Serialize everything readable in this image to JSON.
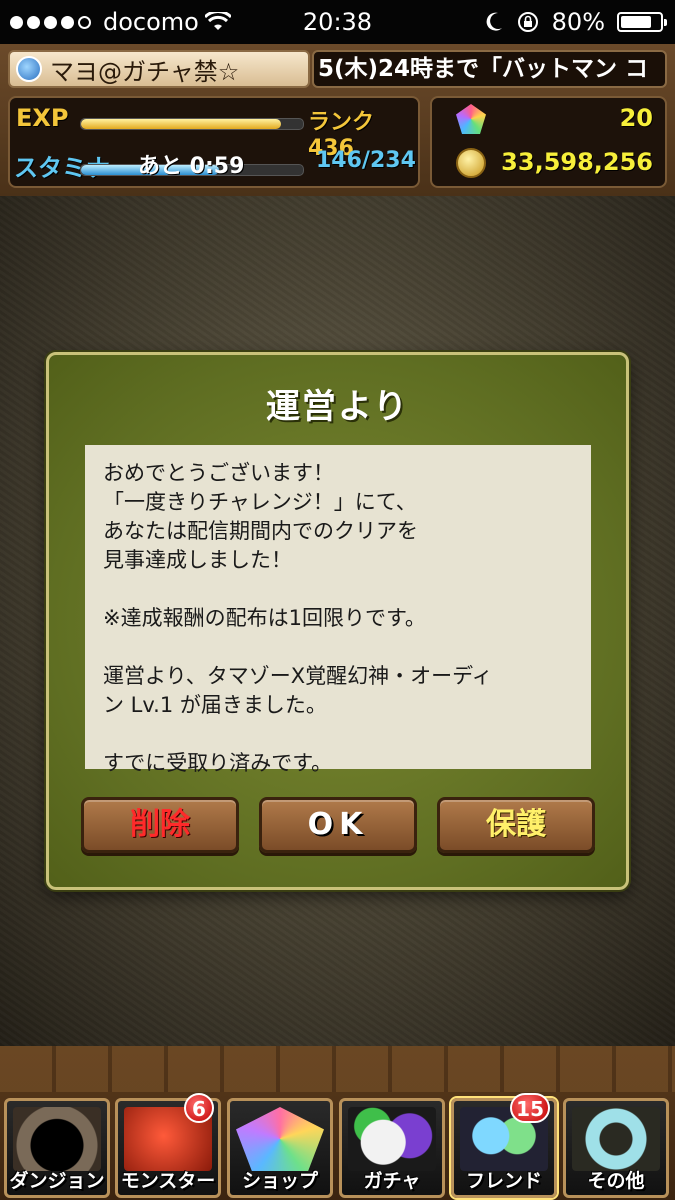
{
  "status_bar": {
    "carrier": "docomo",
    "time": "20:38",
    "battery": "80%",
    "battery_level": 0.8,
    "signal_bars_filled": 4,
    "signal_bars_total": 5
  },
  "header": {
    "player_name": "マヨ@ガチャ禁☆",
    "ticker_text": "5(木)24時まで「バットマン コ",
    "exp_label": "EXP",
    "exp_progress": 0.9,
    "rank": "ランク 436",
    "stamina_label": "スタミナ",
    "stamina_timer": "あと 0:59",
    "stamina_progress": 0.62,
    "stamina_value": "146/234",
    "magic_stones": "20",
    "coins": "33,598,256"
  },
  "dialog": {
    "title": "運営より",
    "message": [
      "おめでとうございます！\n「一度きりチャレンジ！」にて、\nあなたは配信期間内でのクリアを\n見事達成しました！",
      "※達成報酬の配布は1回限りです。",
      "運営より、タマゾーX覚醒幻神・オーディ\nン Lv.1 が届きました。",
      "すでに受取り済みです。"
    ],
    "buttons": {
      "delete": "削除",
      "ok": "OK",
      "protect": "保護"
    }
  },
  "nav": {
    "items": [
      {
        "label": "ダンジョン",
        "icon": "dungeon-gate-icon",
        "badge": ""
      },
      {
        "label": "モンスター",
        "icon": "monster-dragon-icon",
        "badge": "6"
      },
      {
        "label": "ショップ",
        "icon": "magic-stone-icon",
        "badge": ""
      },
      {
        "label": "ガチャ",
        "icon": "egg-icon",
        "badge": ""
      },
      {
        "label": "フレンド",
        "icon": "friends-icon",
        "badge": "15"
      },
      {
        "label": "その他",
        "icon": "question-mark-icon",
        "badge": ""
      }
    ]
  },
  "colors": {
    "exp": "#f4c63a",
    "stamina": "#5fc7f2",
    "delete_text": "#ff2a2a",
    "protect_text": "#fff06a",
    "dialog_bg": "#6b7a28"
  }
}
